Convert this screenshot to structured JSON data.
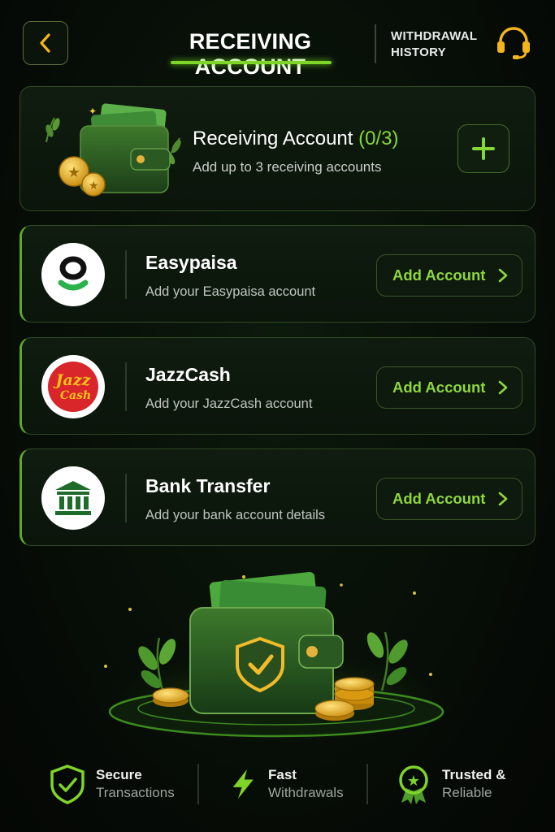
{
  "header": {
    "title": "RECEIVING ACCOUNT",
    "history_label_line1": "WITHDRAWAL",
    "history_label_line2": "HISTORY"
  },
  "summary": {
    "title": "Receiving Account",
    "count": "(0/3)",
    "subtitle": "Add up to 3 receiving accounts",
    "add_icon": "plus-icon"
  },
  "methods": [
    {
      "title": "Easypaisa",
      "subtitle": "Add your Easypaisa account",
      "button": "Add Account",
      "logo": "easypaisa-logo"
    },
    {
      "title": "JazzCash",
      "subtitle": "Add your JazzCash account",
      "button": "Add Account",
      "logo": "jazzcash-logo",
      "logo_text_1": "Jazz",
      "logo_text_2": "Cash"
    },
    {
      "title": "Bank Transfer",
      "subtitle": "Add your bank account details",
      "button": "Add Account",
      "logo": "bank-icon"
    }
  ],
  "features": [
    {
      "line1": "Secure",
      "line2": "Transactions",
      "icon": "shield-check-icon"
    },
    {
      "line1": "Fast",
      "line2": "Withdrawals",
      "icon": "lightning-icon"
    },
    {
      "line1": "Trusted &",
      "line2": "Reliable",
      "icon": "award-badge-icon"
    }
  ],
  "colors": {
    "accent": "#86d636",
    "gold": "#f2b61c",
    "background": "#060b06",
    "card_border": "#2f4a25"
  }
}
